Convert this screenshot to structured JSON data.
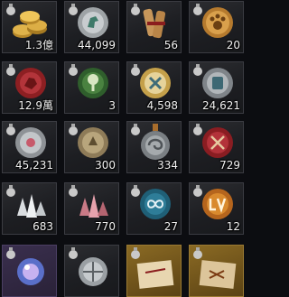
{
  "inventory": {
    "slots": [
      {
        "icon": "gold-coins-icon",
        "quantity": "1.3億"
      },
      {
        "icon": "silver-horse-seal-icon",
        "quantity": "44,099"
      },
      {
        "icon": "scroll-bundle-icon",
        "quantity": "56"
      },
      {
        "icon": "paw-seal-icon",
        "quantity": "20"
      },
      {
        "icon": "red-wax-seal-icon",
        "quantity": "12.9萬"
      },
      {
        "icon": "green-tree-seal-icon",
        "quantity": "3"
      },
      {
        "icon": "gold-rune-seal-icon",
        "quantity": "4,598"
      },
      {
        "icon": "silver-rune-seal-icon",
        "quantity": "24,621"
      },
      {
        "icon": "silver-pink-seal-icon",
        "quantity": "45,231"
      },
      {
        "icon": "bronze-token-icon",
        "quantity": "300"
      },
      {
        "icon": "swirl-medallion-icon",
        "quantity": "334"
      },
      {
        "icon": "crossed-swords-seal-icon",
        "quantity": "729"
      },
      {
        "icon": "white-crystal-icon",
        "quantity": "683"
      },
      {
        "icon": "pink-crystal-icon",
        "quantity": "770"
      },
      {
        "icon": "infinity-seal-icon",
        "quantity": "27"
      },
      {
        "icon": "lv-seal-icon",
        "quantity": "12"
      },
      {
        "icon": "arcane-orb-icon",
        "quantity": ""
      },
      {
        "icon": "compass-coin-icon",
        "quantity": ""
      },
      {
        "icon": "parchment-map-icon",
        "quantity": ""
      },
      {
        "icon": "treasure-map-icon",
        "quantity": ""
      }
    ]
  },
  "colors": {
    "slot_border": "#3b3c42",
    "quantity_text": "#f2f2f2",
    "gold_slot": "#8a6a24"
  }
}
